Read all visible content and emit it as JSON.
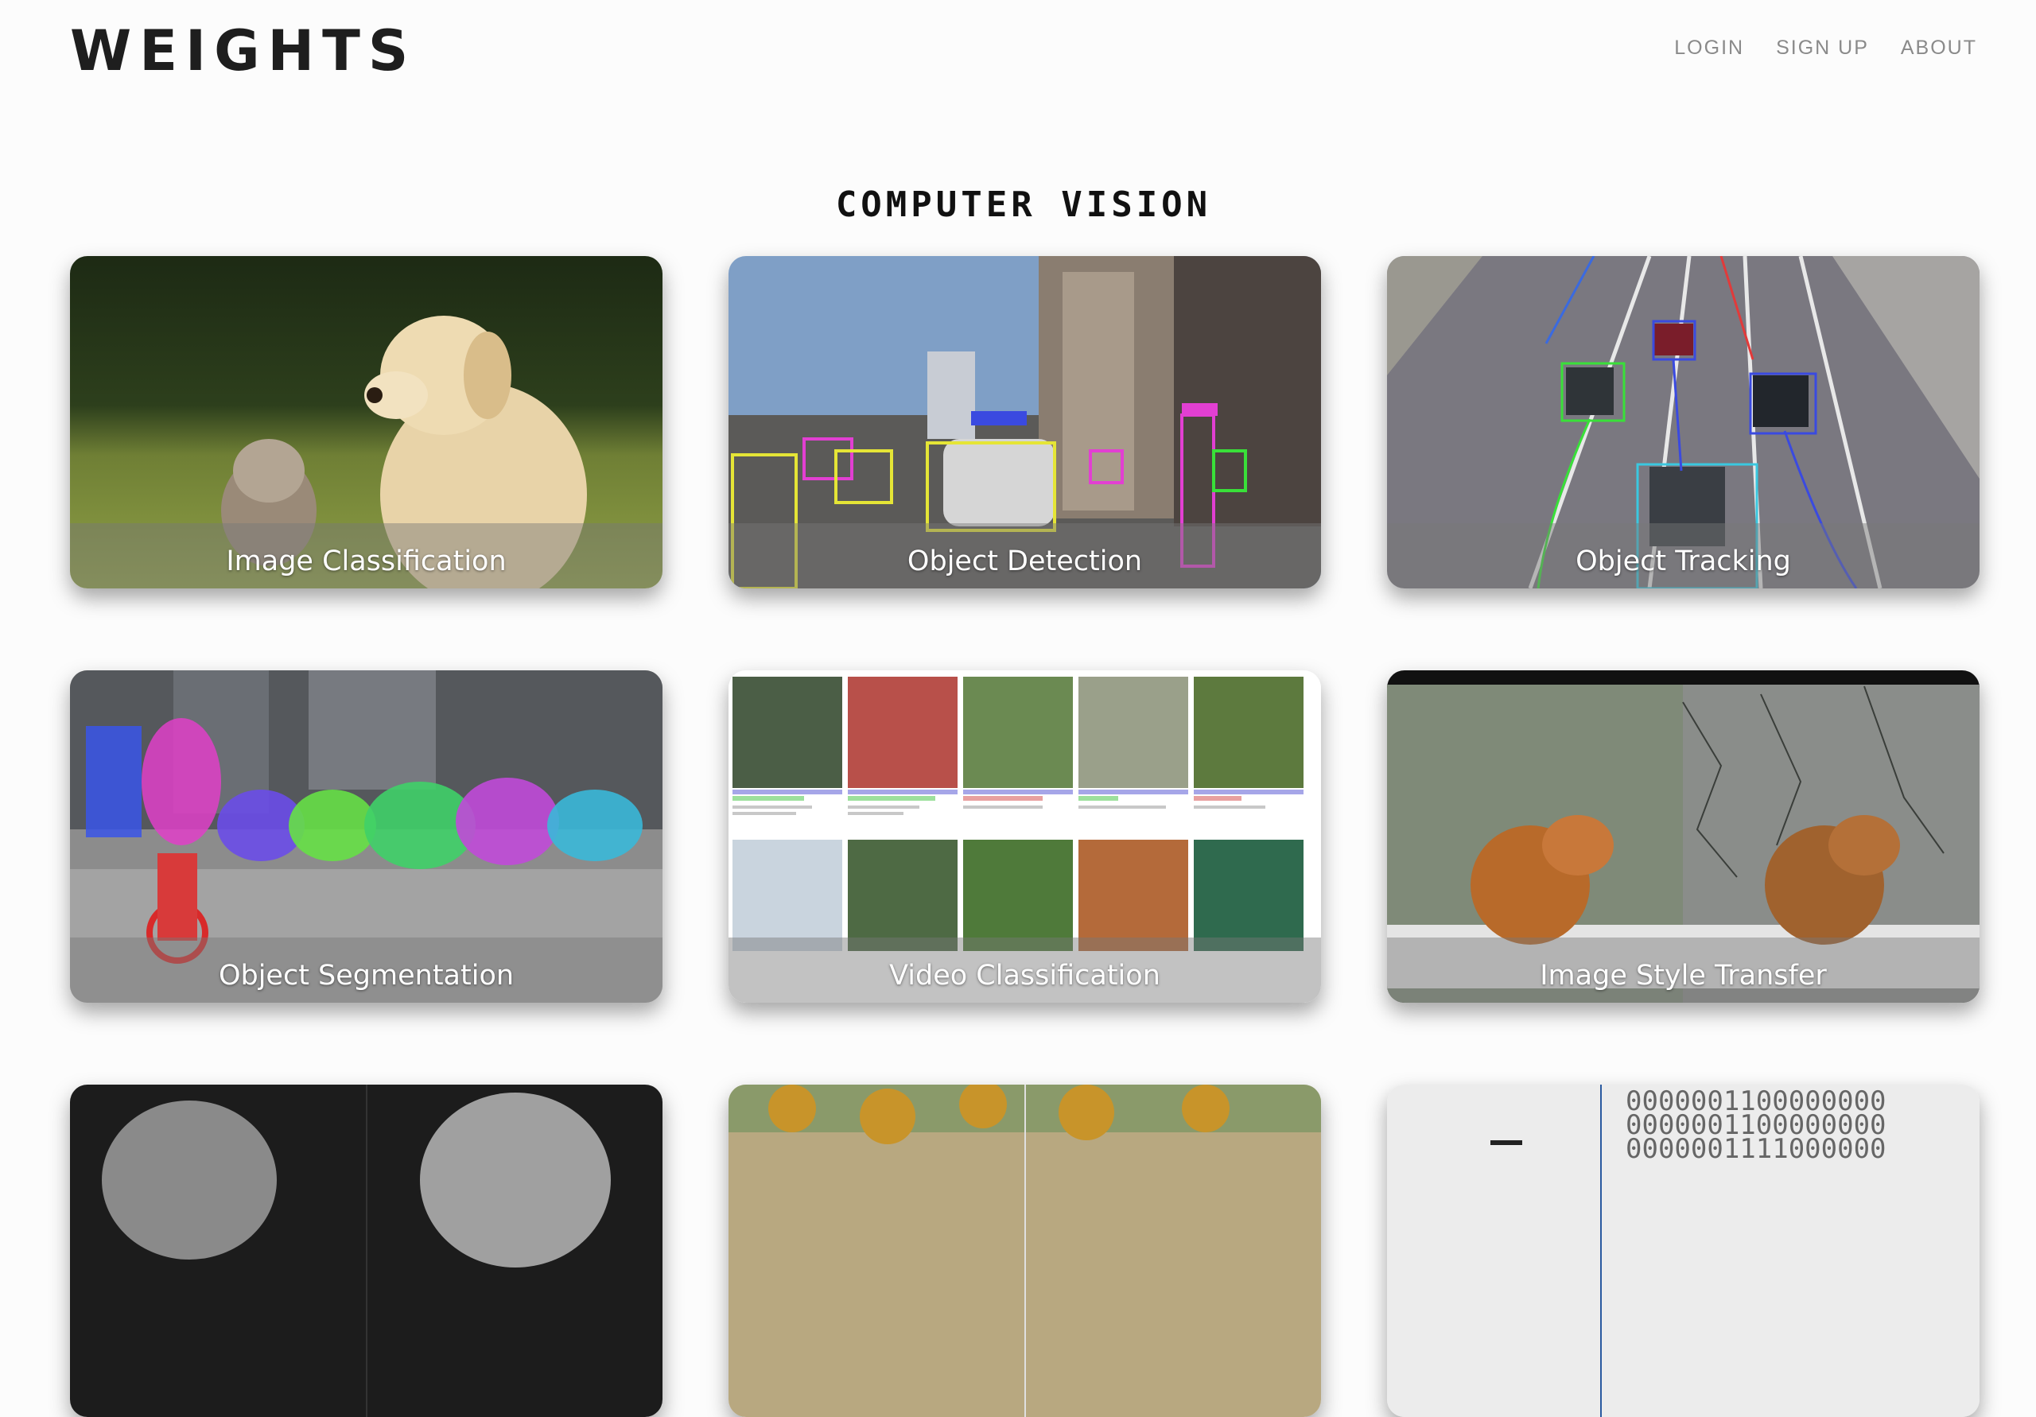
{
  "header": {
    "logo": "WEIGHTS",
    "nav": [
      "LOGIN",
      "SIGN UP",
      "ABOUT"
    ]
  },
  "section": {
    "title": "COMPUTER VISION"
  },
  "cards": [
    {
      "label": "Image Classification"
    },
    {
      "label": "Object Detection"
    },
    {
      "label": "Object Tracking"
    },
    {
      "label": "Object Segmentation"
    },
    {
      "label": "Video Classification"
    },
    {
      "label": "Image Style Transfer"
    }
  ],
  "binary_rows": [
    "0000001100000000",
    "0000001100000000",
    "0000001111000000"
  ],
  "colors": {
    "text_dark": "#1e1e1e",
    "nav_gray": "#8a8a8a",
    "background": "#fcfcfc"
  }
}
